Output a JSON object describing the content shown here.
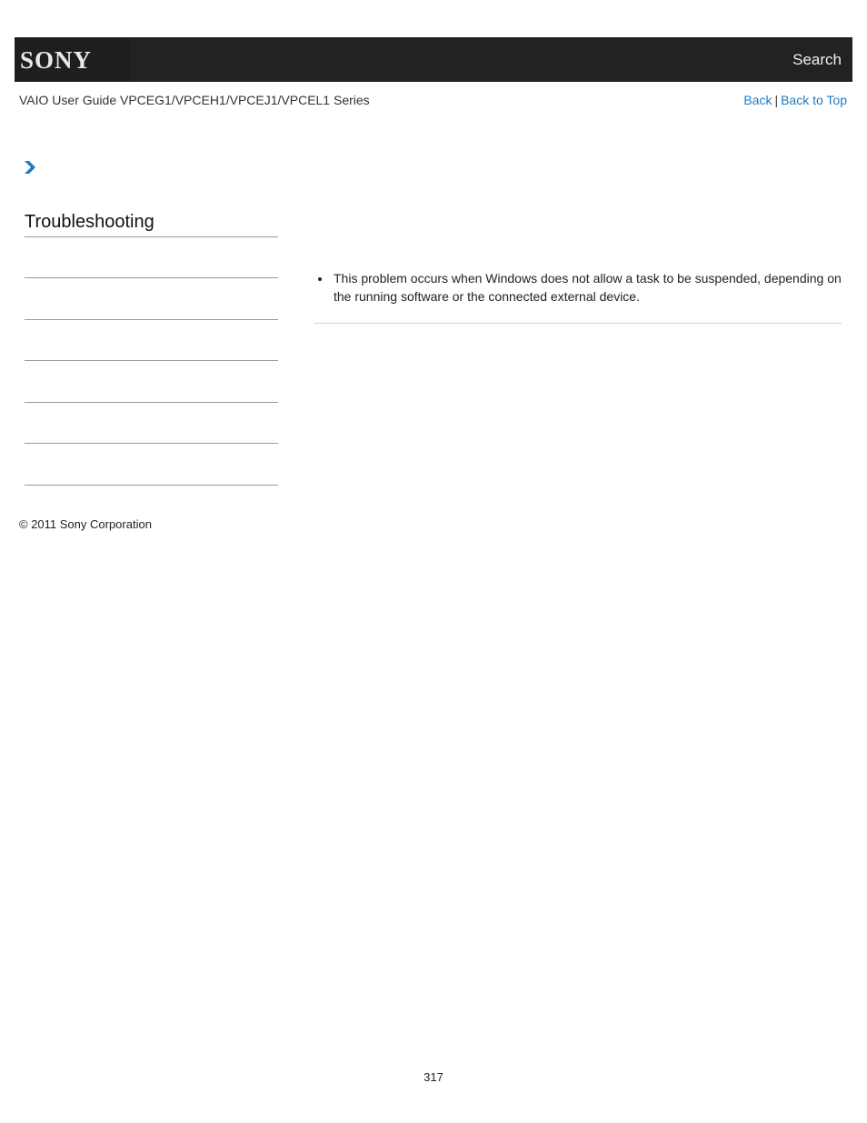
{
  "header": {
    "logo": "SONY",
    "search_label": "Search"
  },
  "subheader": {
    "guide_title": "VAIO User Guide VPCEG1/VPCEH1/VPCEJ1/VPCEL1 Series",
    "back_label": "Back",
    "separator": "|",
    "back_to_top_label": "Back to Top"
  },
  "breadcrumb": {
    "icon": "chevron-right-icon",
    "accent_color": "#1a7bc7"
  },
  "sidebar": {
    "section_title": "Troubleshooting",
    "items": [
      "",
      "",
      "",
      "",
      "",
      ""
    ]
  },
  "main": {
    "bullets": [
      "This problem occurs when Windows does not allow a task to be suspended, depending on the running software or the connected external device."
    ]
  },
  "footer": {
    "copyright": "© 2011 Sony Corporation",
    "page_number": "317"
  }
}
